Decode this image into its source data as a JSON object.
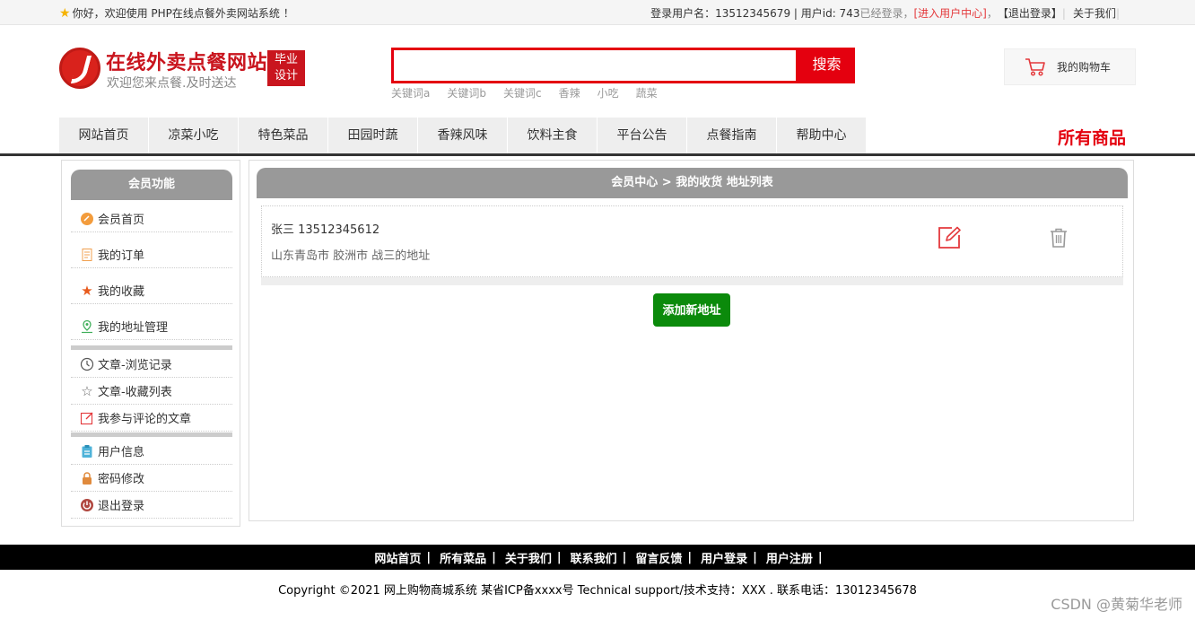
{
  "topbar": {
    "welcome": "你好，欢迎使用 PHP在线点餐外卖网站系统 ！",
    "user_info": "登录用户名：13512345679 | 用户id: 743",
    "logged_in": "已经登录，",
    "enter_center": "[进入用户中心]",
    "comma": "，",
    "logout": "【退出登录】",
    "about": "关于我们"
  },
  "header": {
    "site_title": "在线外卖点餐网站",
    "site_subtitle": "欢迎您来点餐.及时送达",
    "badge_line1": "毕业",
    "badge_line2": "设计",
    "search_value": "",
    "search_button": "搜索",
    "keywords": [
      "关键词a",
      "关键词b",
      "关键词c",
      "香辣",
      "小吃",
      "蔬菜"
    ],
    "cart_label": "我的购物车"
  },
  "nav": {
    "items": [
      "网站首页",
      "凉菜小吃",
      "特色菜品",
      "田园时蔬",
      "香辣风味",
      "饮料主食",
      "平台公告",
      "点餐指南",
      "帮助中心"
    ],
    "all_goods": "所有商品"
  },
  "sidebar": {
    "title": "会员功能",
    "items": [
      "会员首页",
      "我的订单",
      "我的收藏",
      "我的地址管理",
      "文章-浏览记录",
      "文章-收藏列表",
      "我参与评论的文章",
      "用户信息",
      "密码修改",
      "退出登录"
    ]
  },
  "main": {
    "breadcrumb": "会员中心 > 我的收货 地址列表",
    "address": {
      "name_phone": "张三 13512345612",
      "detail": "山东青岛市 胶洲市 战三的地址"
    },
    "add_button": "添加新地址"
  },
  "footer": {
    "links": [
      "网站首页",
      "所有菜品",
      "关于我们",
      "联系我们",
      "留言反馈",
      "用户登录",
      "用户注册"
    ],
    "pipe": "|",
    "copyright": "Copyright ©2021 网上购物商城系统 某省ICP备xxxx号 Technical support/技术支持：XXX . 联系电话：13012345678",
    "watermark": "CSDN @黄菊华老师"
  },
  "colors": {
    "brand_red": "#e4000f",
    "green_button": "#0b8a0b",
    "panel_gray": "#999999"
  }
}
